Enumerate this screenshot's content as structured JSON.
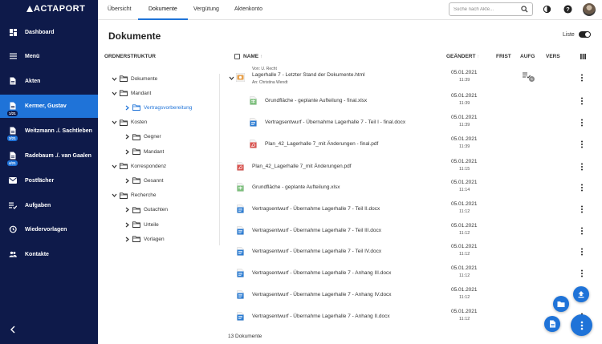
{
  "app": {
    "logo": "ACTAPORT"
  },
  "sidebar": {
    "items": [
      {
        "label": "Dashboard",
        "icon": "dashboard-icon"
      },
      {
        "label": "Menü",
        "icon": "menu-icon"
      },
      {
        "label": "Akten",
        "icon": "file-icon"
      },
      {
        "label": "Kermer, Gustav",
        "icon": "file-icon",
        "badge": "1/21",
        "active": true
      },
      {
        "label": "Weitzmann ./. Sachtleben",
        "icon": "file-icon",
        "badge": "3/21"
      },
      {
        "label": "Radebaum ./. van Gaalen",
        "icon": "file-icon",
        "badge": "4/21"
      },
      {
        "label": "Postfächer",
        "icon": "mail-icon"
      },
      {
        "label": "Aufgaben",
        "icon": "tasks-icon"
      },
      {
        "label": "Wiedervorlagen",
        "icon": "history-icon"
      },
      {
        "label": "Kontakte",
        "icon": "people-icon"
      }
    ],
    "collapse": "‹"
  },
  "topbar": {
    "tabs": [
      "Übersicht",
      "Dokumente",
      "Vergütung",
      "Aktenkonto"
    ],
    "active_tab": "Dokumente",
    "search": {
      "placeholder": "Suche nach Akte...",
      "value": ""
    }
  },
  "page": {
    "title": "Dokumente",
    "list_toggle_label": "Liste"
  },
  "tree": {
    "header": "ORDNERSTRUKTUR",
    "nodes": [
      {
        "label": "Dokumente",
        "level": 0,
        "expanded": true
      },
      {
        "label": "Mandant",
        "level": 1,
        "expanded": true
      },
      {
        "label": "Vertragsvorbereitung",
        "level": 2,
        "expanded": false,
        "selected": true
      },
      {
        "label": "Kosten",
        "level": 1,
        "expanded": true
      },
      {
        "label": "Gegner",
        "level": 2,
        "expanded": false
      },
      {
        "label": "Mandant",
        "level": 2,
        "expanded": false
      },
      {
        "label": "Korrespondenz",
        "level": 1,
        "expanded": true
      },
      {
        "label": "Gesannt",
        "level": 2,
        "expanded": false
      },
      {
        "label": "Recherche",
        "level": 1,
        "expanded": true
      },
      {
        "label": "Gutachten",
        "level": 2,
        "expanded": false
      },
      {
        "label": "Urteile",
        "level": 2,
        "expanded": false
      },
      {
        "label": "Vorlagen",
        "level": 2,
        "expanded": false
      }
    ]
  },
  "table": {
    "columns": {
      "name": "NAME",
      "changed": "GEÄNDERT",
      "deadline": "FRIST",
      "task": "AUFG",
      "version": "VERS"
    },
    "task_badge": "5",
    "rows": [
      {
        "type": "html",
        "from": "Von: U. Recht",
        "name": "Lagerhalle 7 - Letzter Stand der Dokumente.html",
        "to": "An: Christina Wendt",
        "date": "05.01.2021",
        "time": "11:39",
        "level": 0,
        "has_task": true,
        "expandable": true
      },
      {
        "type": "xlsx",
        "name": "Grundfläche - geplante Aufteilung - final.xlsx",
        "date": "05.01.2021",
        "time": "11:39",
        "level": 1
      },
      {
        "type": "docx",
        "name": "Vertragsentwurf - Übernahme Lagerhalle 7 - Teil I - final.docx",
        "date": "05.01.2021",
        "time": "11:39",
        "level": 1
      },
      {
        "type": "pdf",
        "name": "Plan_42_Lagerhalle 7_mit Änderungen - final.pdf",
        "date": "05.01.2021",
        "time": "11:39",
        "level": 1
      },
      {
        "type": "pdf",
        "name": "Plan_42_Lagerhalle 7_mit Änderungen.pdf",
        "date": "05.01.2021",
        "time": "11:15",
        "level": 0
      },
      {
        "type": "xlsx",
        "name": "Grundfläche - geplante Aufteilung.xlsx",
        "date": "05.01.2021",
        "time": "11:14",
        "level": 0
      },
      {
        "type": "docx",
        "name": "Vertragsentwurf - Übernahme Lagerhalle 7 - Teil II.docx",
        "date": "05.01.2021",
        "time": "11:12",
        "level": 0
      },
      {
        "type": "docx",
        "name": "Vertragsentwurf - Übernahme Lagerhalle 7 - Teil III.docx",
        "date": "05.01.2021",
        "time": "11:12",
        "level": 0
      },
      {
        "type": "docx",
        "name": "Vertragsentwurf - Übernahme Lagerhalle 7 - Teil IV.docx",
        "date": "05.01.2021",
        "time": "11:12",
        "level": 0
      },
      {
        "type": "docx",
        "name": "Vertragsentwurf - Übernahme Lagerhalle 7 - Anhang III.docx",
        "date": "05.01.2021",
        "time": "11:12",
        "level": 0
      },
      {
        "type": "docx",
        "name": "Vertragsentwurf - Übernahme Lagerhalle 7 - Anhang IV.docx",
        "date": "05.01.2021",
        "time": "11:12",
        "level": 0
      },
      {
        "type": "docx",
        "name": "Vertragsentwurf - Übernahme Lagerhalle 7 - Anhang II.docx",
        "date": "05.01.2021",
        "time": "11:12",
        "level": 0
      }
    ],
    "count": "13 Dokumente"
  },
  "colors": {
    "sidebar_bg": "#0e1a4a",
    "accent": "#1f73d8",
    "docx": "#2b7cd3",
    "xlsx": "#7bbf7b",
    "pdf": "#d9534f",
    "html": "#e8a04b"
  }
}
